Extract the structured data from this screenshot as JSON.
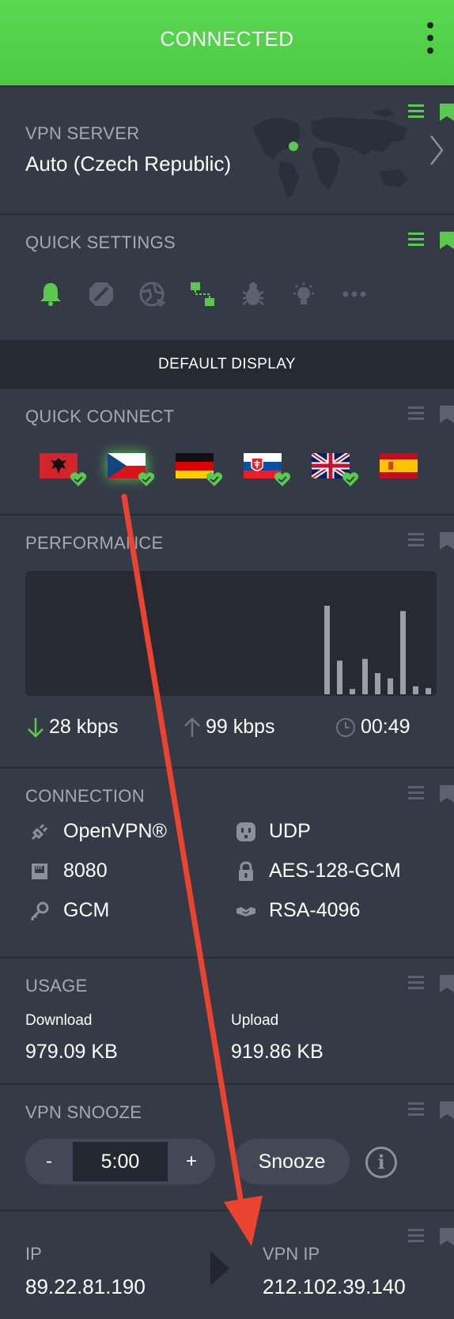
{
  "header": {
    "status": "CONNECTED"
  },
  "vpn_server": {
    "title": "VPN SERVER",
    "value": "Auto (Czech Republic)"
  },
  "quick_settings": {
    "title": "QUICK SETTINGS",
    "icons": [
      "bell-icon",
      "block-icon",
      "globe-icon",
      "network-icon",
      "bug-icon",
      "bulb-icon",
      "more-icon"
    ]
  },
  "display_mode": {
    "label": "DEFAULT DISPLAY"
  },
  "quick_connect": {
    "title": "QUICK CONNECT",
    "flags": [
      {
        "country": "Albania",
        "checked": true
      },
      {
        "country": "Czech Republic",
        "checked": true,
        "active": true
      },
      {
        "country": "Germany",
        "checked": true
      },
      {
        "country": "Slovakia",
        "checked": true
      },
      {
        "country": "United Kingdom",
        "checked": true
      },
      {
        "country": "Spain",
        "checked": false
      }
    ]
  },
  "performance": {
    "title": "PERFORMANCE",
    "bars": [
      0.0,
      0.0,
      0.0,
      0.0,
      0.0,
      0.0,
      0.0,
      0.0,
      0.0,
      0.0,
      0.0,
      0.0,
      0.0,
      0.0,
      0.0,
      0.0,
      0.0,
      0.0,
      0.0,
      0.0,
      0.0,
      0.0,
      0.0,
      0.0,
      1.0,
      0.38,
      0.06,
      0.4,
      0.24,
      0.18,
      0.94,
      0.09,
      0.07
    ],
    "download": "28 kbps",
    "upload": "99 kbps",
    "duration": "00:49"
  },
  "connection": {
    "title": "CONNECTION",
    "protocol": "OpenVPN®",
    "transport": "UDP",
    "port": "8080",
    "cipher": "AES-128-GCM",
    "auth": "GCM",
    "handshake": "RSA-4096"
  },
  "usage": {
    "title": "USAGE",
    "download_label": "Download",
    "download_value": "979.09 KB",
    "upload_label": "Upload",
    "upload_value": "919.86 KB"
  },
  "snooze": {
    "title": "VPN SNOOZE",
    "minus": "-",
    "value": "5:00",
    "plus": "+",
    "button": "Snooze",
    "info": "i"
  },
  "ip": {
    "ip_label": "IP",
    "ip_value": "89.22.81.190",
    "vpn_ip_label": "VPN IP",
    "vpn_ip_value": "212.102.39.140"
  },
  "colors": {
    "accent": "#5bc94f",
    "background": "#353a47",
    "annotation_arrow": "#ea4330"
  }
}
